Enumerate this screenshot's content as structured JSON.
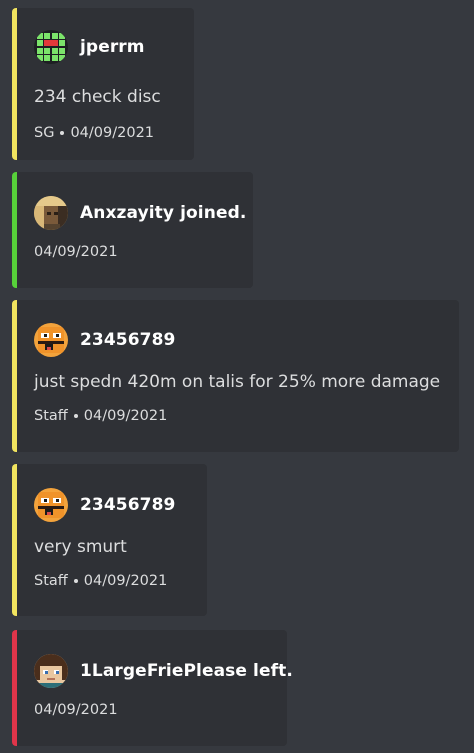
{
  "embeds": [
    {
      "accent": "#f1e45f",
      "author": "jperrm",
      "avatar": "grid-avatar-icon",
      "description": "234 check disc",
      "footer_prefix": "SG",
      "timestamp": "04/09/2021"
    },
    {
      "accent": "#57d13a",
      "author": "Anxzayity joined.",
      "avatar": "blonde-avatar-icon",
      "timestamp": "04/09/2021"
    },
    {
      "accent": "#f1e45f",
      "author": "23456789",
      "avatar": "orange-face-avatar-icon",
      "description": "just spedn 420m on talis for 25% more damage",
      "footer_prefix": "Staff",
      "timestamp": "04/09/2021"
    },
    {
      "accent": "#f1e45f",
      "author": "23456789",
      "avatar": "orange-face-avatar-icon",
      "description": "very smurt",
      "footer_prefix": "Staff",
      "timestamp": "04/09/2021"
    },
    {
      "accent": "#e0354a",
      "author": "1LargeFriePlease left.",
      "avatar": "brown-hair-avatar-icon",
      "timestamp": "04/09/2021"
    }
  ]
}
